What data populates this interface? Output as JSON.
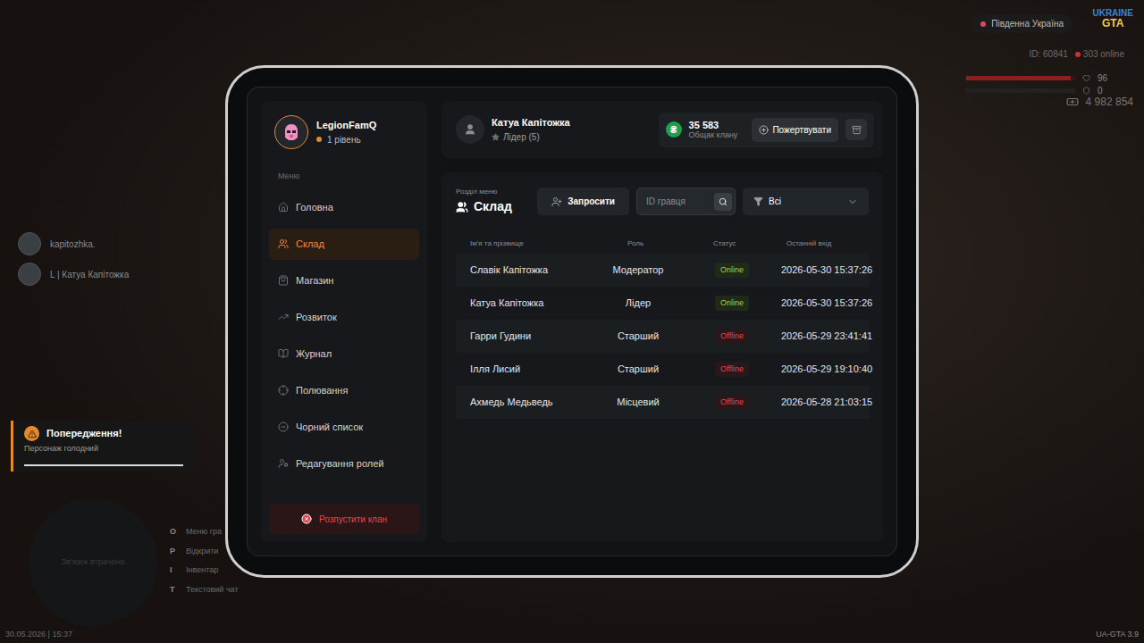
{
  "hud": {
    "server": "Південна Україна",
    "logo": [
      "UKRAINE",
      "GTA"
    ],
    "player_id": "ID: 60841",
    "online": "303 online",
    "health": "96",
    "health_level": 0.96,
    "armor": "0",
    "armor_level": 0,
    "money": "4 982 854"
  },
  "voice_chat": [
    {
      "name": "kapitozhka."
    },
    {
      "name": "L | Катуа Капітожка"
    }
  ],
  "notification": {
    "title": "Попередження!",
    "text": "Персонаж голодний",
    "level": 1
  },
  "minimap": {
    "text": "Зв'язок втрачено"
  },
  "key_hints": [
    {
      "key": "O",
      "label": "Меню гра"
    },
    {
      "key": "P",
      "label": "Відкрити"
    },
    {
      "key": "I",
      "label": "Інвентар"
    },
    {
      "key": "T",
      "label": "Текстовий чат"
    }
  ],
  "datetime": "30.05.2026 | 15:37",
  "version": "UA-GTA 3.9",
  "tablet": {
    "clan": {
      "name": "LegionFamQ",
      "level": "1 рівень"
    },
    "menu_label": "Меню",
    "menu": [
      {
        "label": "Головна",
        "selected": false
      },
      {
        "label": "Склад",
        "selected": true
      },
      {
        "label": "Магазин",
        "selected": false
      },
      {
        "label": "Розвиток",
        "selected": false
      },
      {
        "label": "Журнал",
        "selected": false
      },
      {
        "label": "Полювання",
        "selected": false
      },
      {
        "label": "Чорний список",
        "selected": false
      },
      {
        "label": "Редагування ролей",
        "selected": false
      }
    ],
    "disband": "Розпустити клан",
    "user": {
      "name": "Катуа Капітожка",
      "rank": "Лідер (5)"
    },
    "balance": {
      "symbol": "₴",
      "amount": "35 583",
      "label": "Общак клану"
    },
    "donate": "Пожертвувати",
    "section": {
      "caption": "Розділ меню",
      "title": "Склад"
    },
    "invite": "Запросити",
    "search": {
      "placeholder": "ID гравця"
    },
    "filter": "Всі",
    "table": {
      "columns": [
        "Ім'я та прізвище",
        "Роль",
        "Статус",
        "Останній вхід"
      ],
      "rows": [
        {
          "name": "Славік Капітожка",
          "role": "Модератор",
          "status": "Online",
          "online": true,
          "color": "#a3d14a",
          "last_login": "2026-05-30 15:37:26"
        },
        {
          "name": "Катуа Капітожка",
          "role": "Лідер",
          "status": "Online",
          "online": true,
          "color": "#a3d14a",
          "last_login": "2026-05-30 15:37:26"
        },
        {
          "name": "Гарри Гудини",
          "role": "Старший",
          "status": "Offline",
          "online": false,
          "color": "#e5484d",
          "last_login": "2026-05-29 23:41:41"
        },
        {
          "name": "Ілля Лисий",
          "role": "Старший",
          "status": "Offline",
          "online": false,
          "color": "#e5484d",
          "last_login": "2026-05-29 19:10:40"
        },
        {
          "name": "Ахмедь Медьведь",
          "role": "Місцевий",
          "status": "Offline",
          "online": false,
          "color": "#e5484d",
          "last_login": "2026-05-28 21:03:15"
        }
      ]
    }
  }
}
